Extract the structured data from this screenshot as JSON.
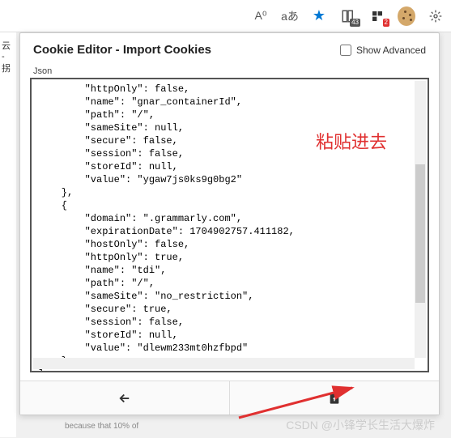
{
  "toolbar": {
    "text_size_label": "A⁰",
    "translate_label": "aあ",
    "collections_badge": "43",
    "ext_badge": "2"
  },
  "page_bg_text": "云 - 拐",
  "popup": {
    "title": "Cookie Editor - Import Cookies",
    "show_advanced_label": "Show Advanced",
    "json_label": "Json",
    "code": "        \"httpOnly\": false,\n        \"name\": \"gnar_containerId\",\n        \"path\": \"/\",\n        \"sameSite\": null,\n        \"secure\": false,\n        \"session\": false,\n        \"storeId\": null,\n        \"value\": \"ygaw7js0ks9g0bg2\"\n    },\n    {\n        \"domain\": \".grammarly.com\",\n        \"expirationDate\": 1704902757.411182,\n        \"hostOnly\": false,\n        \"httpOnly\": true,\n        \"name\": \"tdi\",\n        \"path\": \"/\",\n        \"sameSite\": \"no_restriction\",\n        \"secure\": true,\n        \"session\": false,\n        \"storeId\": null,\n        \"value\": \"dlewm233mt0hzfbpd\"\n    }\n]"
  },
  "annotation": "粘贴进去",
  "watermark": "CSDN @小锋学长生活大爆炸",
  "hidden_bg": "because that 10% of"
}
